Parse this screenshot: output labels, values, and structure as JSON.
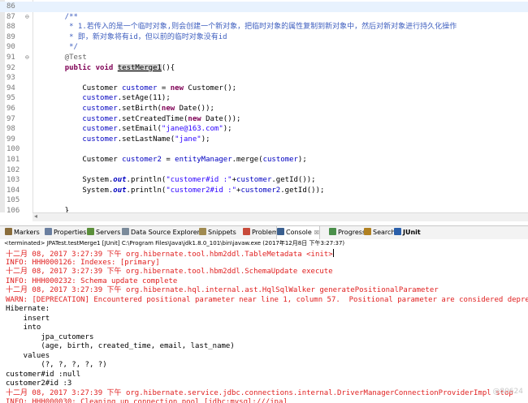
{
  "editor": {
    "lines": [
      {
        "num": "86",
        "fold": "",
        "current": true,
        "segs": []
      },
      {
        "num": "87",
        "fold": "⊖",
        "segs": [
          {
            "t": "    /**",
            "c": "jd"
          }
        ]
      },
      {
        "num": "88",
        "fold": "",
        "segs": [
          {
            "t": "     * 1.若传入的是一个临时对象,则会创建一个新对象，把临时对象的属性复制到新对象中，然后对新对象进行持久化操作",
            "c": "jd"
          }
        ]
      },
      {
        "num": "89",
        "fold": "",
        "segs": [
          {
            "t": "     * 即，新对象将有id，但以前的临时对象没有id",
            "c": "jd"
          }
        ]
      },
      {
        "num": "90",
        "fold": "",
        "segs": [
          {
            "t": "     */",
            "c": "jd"
          }
        ]
      },
      {
        "num": "91",
        "fold": "⊖",
        "segs": [
          {
            "t": "    @Test",
            "c": "ann"
          }
        ]
      },
      {
        "num": "92",
        "fold": "",
        "segs": [
          {
            "t": "    "
          },
          {
            "t": "public",
            "c": "kw"
          },
          {
            "t": " "
          },
          {
            "t": "void",
            "c": "kw"
          },
          {
            "t": " "
          },
          {
            "t": "testMerge1",
            "c": "fn-hl"
          },
          {
            "t": "(){"
          }
        ]
      },
      {
        "num": "93",
        "fold": "",
        "segs": []
      },
      {
        "num": "94",
        "fold": "",
        "segs": [
          {
            "t": "        Customer "
          },
          {
            "t": "customer",
            "c": "var"
          },
          {
            "t": " = "
          },
          {
            "t": "new",
            "c": "kw"
          },
          {
            "t": " Customer();"
          }
        ]
      },
      {
        "num": "95",
        "fold": "",
        "segs": [
          {
            "t": "        "
          },
          {
            "t": "customer",
            "c": "var"
          },
          {
            "t": ".setAge(11);"
          }
        ]
      },
      {
        "num": "96",
        "fold": "",
        "segs": [
          {
            "t": "        "
          },
          {
            "t": "customer",
            "c": "var"
          },
          {
            "t": ".setBirth("
          },
          {
            "t": "new",
            "c": "kw"
          },
          {
            "t": " Date());"
          }
        ]
      },
      {
        "num": "97",
        "fold": "",
        "segs": [
          {
            "t": "        "
          },
          {
            "t": "customer",
            "c": "var"
          },
          {
            "t": ".setCreatedTime("
          },
          {
            "t": "new",
            "c": "kw"
          },
          {
            "t": " Date());"
          }
        ]
      },
      {
        "num": "98",
        "fold": "",
        "segs": [
          {
            "t": "        "
          },
          {
            "t": "customer",
            "c": "var"
          },
          {
            "t": ".setEmail("
          },
          {
            "t": "\"jane@163.com\"",
            "c": "str"
          },
          {
            "t": ");"
          }
        ]
      },
      {
        "num": "99",
        "fold": "",
        "segs": [
          {
            "t": "        "
          },
          {
            "t": "customer",
            "c": "var"
          },
          {
            "t": ".setLastName("
          },
          {
            "t": "\"jane\"",
            "c": "str"
          },
          {
            "t": ");"
          }
        ]
      },
      {
        "num": "100",
        "fold": "",
        "segs": []
      },
      {
        "num": "101",
        "fold": "",
        "segs": [
          {
            "t": "        Customer "
          },
          {
            "t": "customer2",
            "c": "var"
          },
          {
            "t": " = "
          },
          {
            "t": "entityManager",
            "c": "var"
          },
          {
            "t": ".merge("
          },
          {
            "t": "customer",
            "c": "var"
          },
          {
            "t": ");"
          }
        ]
      },
      {
        "num": "102",
        "fold": "",
        "segs": []
      },
      {
        "num": "103",
        "fold": "",
        "segs": [
          {
            "t": "        System."
          },
          {
            "t": "out",
            "c": "st"
          },
          {
            "t": ".println("
          },
          {
            "t": "\"customer#id :\"",
            "c": "str"
          },
          {
            "t": "+"
          },
          {
            "t": "customer",
            "c": "var"
          },
          {
            "t": ".getId());"
          }
        ]
      },
      {
        "num": "104",
        "fold": "",
        "segs": [
          {
            "t": "        System."
          },
          {
            "t": "out",
            "c": "st"
          },
          {
            "t": ".println("
          },
          {
            "t": "\"customer2#id :\"",
            "c": "str"
          },
          {
            "t": "+"
          },
          {
            "t": "customer2",
            "c": "var"
          },
          {
            "t": ".getId());"
          }
        ]
      },
      {
        "num": "105",
        "fold": "",
        "segs": []
      },
      {
        "num": "106",
        "fold": "",
        "segs": [
          {
            "t": "    }"
          }
        ]
      }
    ]
  },
  "view_tabs": [
    {
      "label": "Markers",
      "icon": "markers-icon",
      "color": "#8a6d3b",
      "active": false
    },
    {
      "label": "Properties",
      "icon": "properties-icon",
      "color": "#6a7fa0",
      "active": false
    },
    {
      "label": "Servers",
      "icon": "servers-icon",
      "color": "#5b8f3a",
      "active": false
    },
    {
      "label": "Data Source Explorer",
      "icon": "data-source-icon",
      "color": "#7a8a9a",
      "active": false
    },
    {
      "label": "Snippets",
      "icon": "snippets-icon",
      "color": "#a08a50",
      "active": false
    },
    {
      "label": "Problems",
      "icon": "problems-icon",
      "color": "#c84a3a",
      "active": false
    },
    {
      "label": "Console",
      "icon": "console-icon",
      "color": "#3a5f8f",
      "active": true,
      "close": "☒"
    },
    {
      "label": "Progress",
      "icon": "progress-icon",
      "color": "#4a8f4a",
      "active": false
    },
    {
      "label": "Search",
      "icon": "search-icon",
      "color": "#b08020",
      "active": false
    },
    {
      "label": "JUnit",
      "icon": "junit-icon",
      "color": "#2a5faa",
      "active": false,
      "bold": true
    }
  ],
  "console": {
    "header": "<terminated> JPATest.testMerge1 [JUnit] C:\\Program Files\\Java\\jdk1.8.0_101\\bin\\javaw.exe (2017年12月8日 下午3:27:37)",
    "lines": [
      {
        "text": "十二月 08, 2017 3:27:39 下午 org.hibernate.tool.hbm2ddl.TableMetadata <init>",
        "err": true,
        "caret": true
      },
      {
        "text": "INFO: HHH000126: Indexes: [primary]",
        "err": true
      },
      {
        "text": "十二月 08, 2017 3:27:39 下午 org.hibernate.tool.hbm2ddl.SchemaUpdate execute",
        "err": true
      },
      {
        "text": "INFO: HHH000232: Schema update complete",
        "err": true
      },
      {
        "text": "十二月 08, 2017 3:27:39 下午 org.hibernate.hql.internal.ast.HqlSqlWalker generatePositionalParameter",
        "err": true
      },
      {
        "text": "WARN: [DEPRECATION] Encountered positional parameter near line 1, column 57.  Positional parameter are considered deprec",
        "err": true
      },
      {
        "text": "Hibernate: ",
        "err": false
      },
      {
        "text": "    insert ",
        "err": false
      },
      {
        "text": "    into",
        "err": false
      },
      {
        "text": "        jpa_cutomers",
        "err": false
      },
      {
        "text": "        (age, birth, created_time, email, last_name) ",
        "err": false
      },
      {
        "text": "    values",
        "err": false
      },
      {
        "text": "        (?, ?, ?, ?, ?)",
        "err": false
      },
      {
        "text": "customer#id :null",
        "err": false
      },
      {
        "text": "customer2#id :3",
        "err": false
      },
      {
        "text": "十二月 08, 2017 3:27:39 下午 org.hibernate.service.jdbc.connections.internal.DriverManagerConnectionProviderImpl stop",
        "err": true
      },
      {
        "text": "INFO: HHH000030: Cleaning up connection pool [jdbc:mysql:///jpa]",
        "err": true
      }
    ],
    "watermark": "@80624"
  }
}
